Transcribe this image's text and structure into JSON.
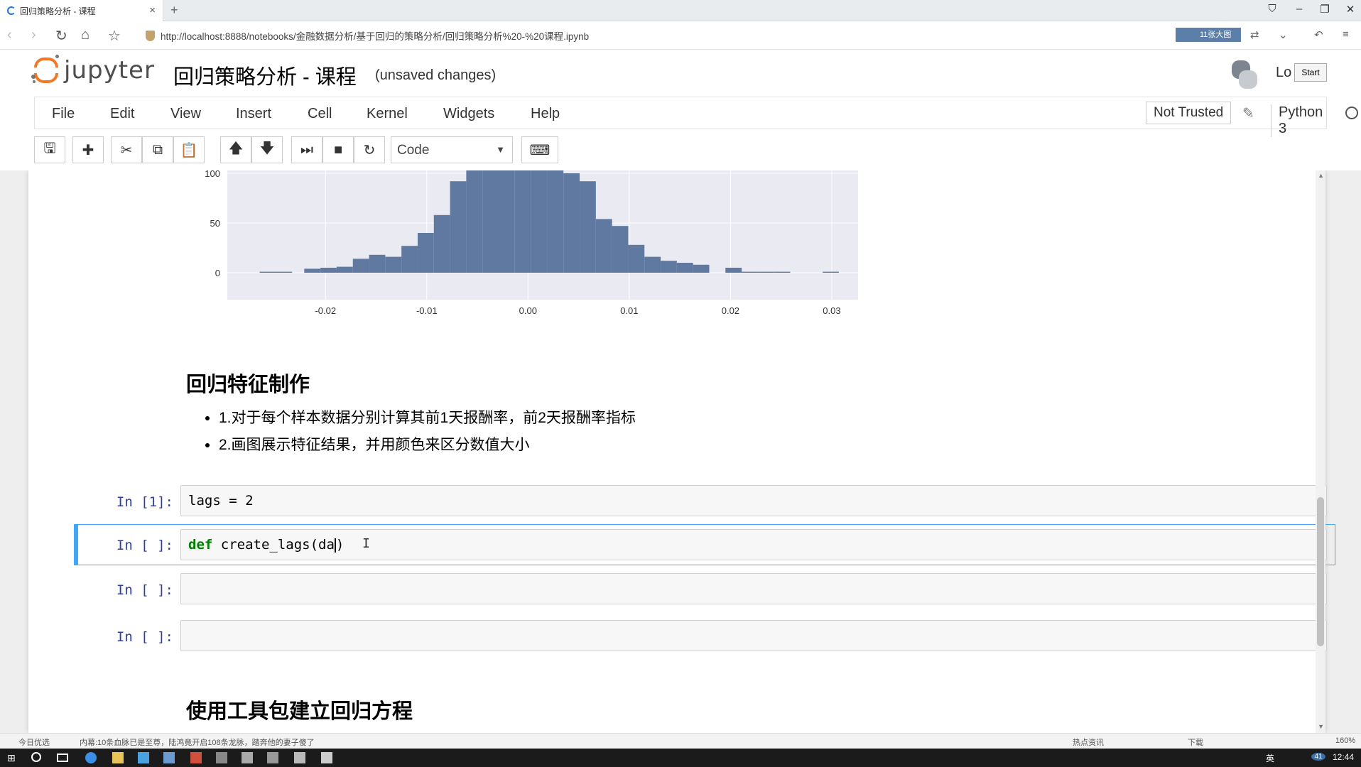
{
  "browser": {
    "tab_title": "回归策略分析 - 课程",
    "url": "http://localhost:8888/notebooks/金融数据分析/基于回归的策略分析/回归策略分析%20-%20课程.ipynb",
    "extension_badge": "11张大图"
  },
  "header": {
    "logo_text": "jupyter",
    "notebook_title": "回归策略分析 - 课程",
    "save_status": "(unsaved changes)",
    "login_text": "Lo",
    "start_button": "Start"
  },
  "menu": {
    "items": [
      "File",
      "Edit",
      "View",
      "Insert",
      "Cell",
      "Kernel",
      "Widgets",
      "Help"
    ],
    "trust_button": "Not Trusted",
    "kernel_name": "Python 3"
  },
  "toolbar": {
    "cell_type": "Code",
    "icons": [
      "save-icon",
      "plus-icon",
      "scissors-icon",
      "copy-icon",
      "paste-icon",
      "arrow-up-icon",
      "arrow-down-icon",
      "run-icon",
      "stop-icon",
      "restart-icon",
      "keyboard-icon"
    ]
  },
  "chart_data": {
    "type": "bar",
    "title": "",
    "xlabel": "",
    "ylabel": "",
    "x_ticks": [
      "-0.02",
      "-0.01",
      "0.00",
      "0.01",
      "0.02",
      "0.03"
    ],
    "x_tick_values": [
      -0.02,
      -0.01,
      0.0,
      0.01,
      0.02,
      0.03
    ],
    "y_ticks": [
      "0",
      "50",
      "100"
    ],
    "y_tick_values": [
      0,
      50,
      100
    ],
    "xlim": [
      -0.0297,
      0.0326
    ],
    "ylim": [
      0,
      103
    ],
    "bar_color": "#6079a0",
    "plot_bg": "#eaeaf2",
    "grid": true,
    "bins": [
      {
        "x0": -0.0265,
        "x1": -0.0233,
        "count": 1
      },
      {
        "x0": -0.0221,
        "x1": -0.0205,
        "count": 4
      },
      {
        "x0": -0.0205,
        "x1": -0.0189,
        "count": 5
      },
      {
        "x0": -0.0189,
        "x1": -0.0173,
        "count": 6
      },
      {
        "x0": -0.0173,
        "x1": -0.0157,
        "count": 14
      },
      {
        "x0": -0.0157,
        "x1": -0.0141,
        "count": 18
      },
      {
        "x0": -0.0141,
        "x1": -0.0125,
        "count": 16
      },
      {
        "x0": -0.0125,
        "x1": -0.0109,
        "count": 27
      },
      {
        "x0": -0.0109,
        "x1": -0.0093,
        "count": 40
      },
      {
        "x0": -0.0093,
        "x1": -0.0077,
        "count": 58
      },
      {
        "x0": -0.0077,
        "x1": -0.0061,
        "count": 92
      },
      {
        "x0": -0.0061,
        "x1": -0.0045,
        "count": 110
      },
      {
        "x0": -0.0045,
        "x1": -0.0029,
        "count": 118
      },
      {
        "x0": -0.0029,
        "x1": -0.0013,
        "count": 125
      },
      {
        "x0": -0.0013,
        "x1": 0.0003,
        "count": 128
      },
      {
        "x0": 0.0003,
        "x1": 0.0019,
        "count": 122
      },
      {
        "x0": 0.0019,
        "x1": 0.0035,
        "count": 112
      },
      {
        "x0": 0.0035,
        "x1": 0.0051,
        "count": 100
      },
      {
        "x0": 0.0051,
        "x1": 0.0067,
        "count": 92
      },
      {
        "x0": 0.0067,
        "x1": 0.0083,
        "count": 54
      },
      {
        "x0": 0.0083,
        "x1": 0.0099,
        "count": 47
      },
      {
        "x0": 0.0099,
        "x1": 0.0115,
        "count": 28
      },
      {
        "x0": 0.0115,
        "x1": 0.0131,
        "count": 16
      },
      {
        "x0": 0.0131,
        "x1": 0.0147,
        "count": 12
      },
      {
        "x0": 0.0147,
        "x1": 0.0163,
        "count": 10
      },
      {
        "x0": 0.0163,
        "x1": 0.0179,
        "count": 8
      },
      {
        "x0": 0.0195,
        "x1": 0.0211,
        "count": 5
      },
      {
        "x0": 0.0211,
        "x1": 0.0227,
        "count": 1
      },
      {
        "x0": 0.0227,
        "x1": 0.0243,
        "count": 1
      },
      {
        "x0": 0.0243,
        "x1": 0.0259,
        "count": 1
      },
      {
        "x0": 0.0291,
        "x1": 0.0307,
        "count": 1
      }
    ]
  },
  "markdown": {
    "heading1": "回归特征制作",
    "list": [
      "1.对于每个样本数据分别计算其前1天报酬率，前2天报酬率指标",
      "2.画图展示特征结果，并用颜色来区分数值大小"
    ],
    "heading2": "使用工具包建立回归方程"
  },
  "cells": [
    {
      "prompt": "In  [1]:",
      "code": "lags = 2"
    },
    {
      "prompt": "In  [ ]:",
      "code_kw": "def",
      "code_rest": " create_lags(da",
      "code_close": ")"
    },
    {
      "prompt": "In  [ ]:",
      "code": ""
    },
    {
      "prompt": "In  [ ]:",
      "code": ""
    }
  ],
  "statusbar": {
    "left": "今日优选",
    "news": "内幕:10条血脉已是至尊，陆鸿竟开启108条龙脉，踏奔他的妻子傻了",
    "right_items": [
      "热点资讯",
      "下载",
      "160%"
    ]
  },
  "taskbar": {
    "lang": "英",
    "time": "12:44",
    "badge": "41"
  }
}
